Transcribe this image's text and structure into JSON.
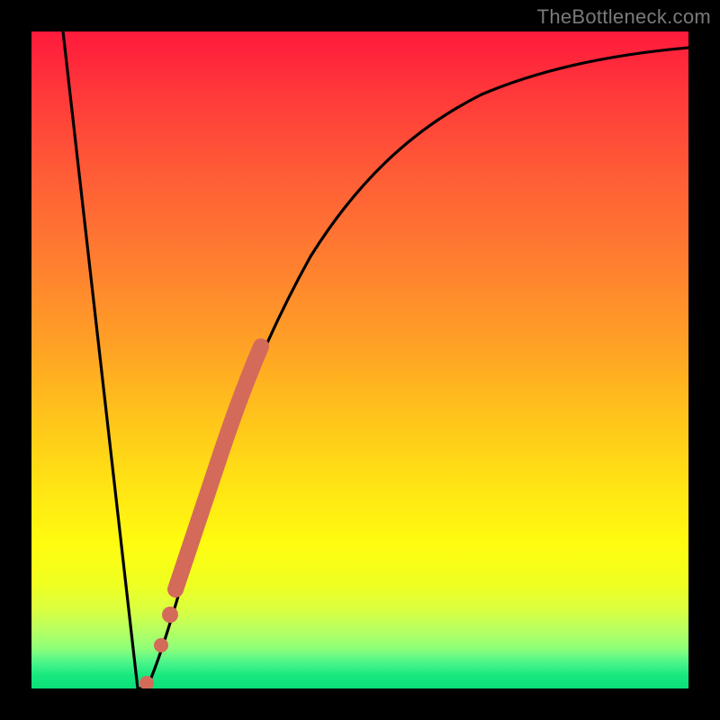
{
  "watermark": "TheBottleneck.com",
  "chart_data": {
    "type": "line",
    "title": "",
    "xlabel": "",
    "ylabel": "",
    "xlim": [
      0,
      100
    ],
    "ylim": [
      0,
      100
    ],
    "series": [
      {
        "name": "bottleneck-curve",
        "x": [
          0,
          3,
          6,
          9,
          12,
          14,
          15,
          16,
          18,
          20,
          24,
          28,
          34,
          42,
          52,
          64,
          78,
          90,
          100
        ],
        "y": [
          100,
          84,
          66,
          46,
          22,
          6,
          0,
          0,
          6,
          16,
          34,
          48,
          62,
          74,
          82,
          88,
          92,
          94,
          95
        ]
      }
    ],
    "highlight_segment": {
      "name": "highlighted-range",
      "color": "#d46a5a",
      "x": [
        16,
        18,
        20,
        22,
        24,
        26,
        28,
        30,
        32,
        34
      ],
      "y": [
        0,
        6,
        16,
        25,
        34,
        42,
        48,
        54,
        58,
        62
      ]
    },
    "highlight_dots": {
      "name": "highlight-dots",
      "color": "#d46a5a",
      "points": [
        {
          "x": 16,
          "y": 0
        },
        {
          "x": 19,
          "y": 10
        },
        {
          "x": 21,
          "y": 20
        }
      ]
    }
  }
}
